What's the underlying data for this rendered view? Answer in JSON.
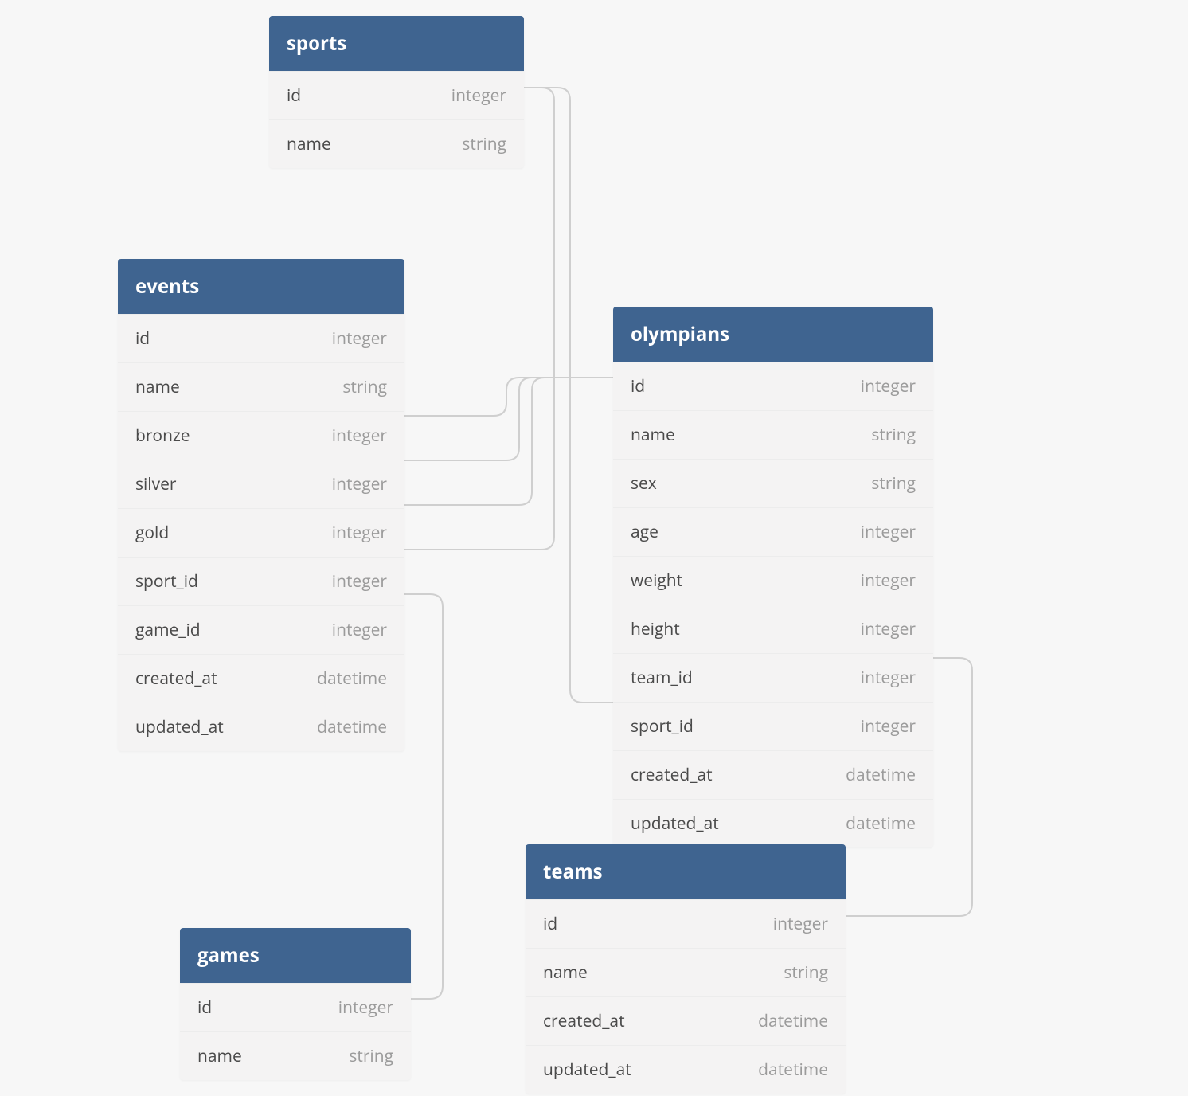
{
  "tables": {
    "sports": {
      "title": "sports",
      "columns": [
        {
          "name": "id",
          "type": "integer"
        },
        {
          "name": "name",
          "type": "string"
        }
      ]
    },
    "events": {
      "title": "events",
      "columns": [
        {
          "name": "id",
          "type": "integer"
        },
        {
          "name": "name",
          "type": "string"
        },
        {
          "name": "bronze",
          "type": "integer"
        },
        {
          "name": "silver",
          "type": "integer"
        },
        {
          "name": "gold",
          "type": "integer"
        },
        {
          "name": "sport_id",
          "type": "integer"
        },
        {
          "name": "game_id",
          "type": "integer"
        },
        {
          "name": "created_at",
          "type": "datetime"
        },
        {
          "name": "updated_at",
          "type": "datetime"
        }
      ]
    },
    "olympians": {
      "title": "olympians",
      "columns": [
        {
          "name": "id",
          "type": "integer"
        },
        {
          "name": "name",
          "type": "string"
        },
        {
          "name": "sex",
          "type": "string"
        },
        {
          "name": "age",
          "type": "integer"
        },
        {
          "name": "weight",
          "type": "integer"
        },
        {
          "name": "height",
          "type": "integer"
        },
        {
          "name": "team_id",
          "type": "integer"
        },
        {
          "name": "sport_id",
          "type": "integer"
        },
        {
          "name": "created_at",
          "type": "datetime"
        }
      ]
    },
    "olympians_extra_last": {
      "name": "updated_at",
      "type": "datetime"
    },
    "games": {
      "title": "games",
      "columns": [
        {
          "name": "id",
          "type": "integer"
        },
        {
          "name": "name",
          "type": "string"
        }
      ]
    },
    "teams": {
      "title": "teams",
      "columns": [
        {
          "name": "id",
          "type": "integer"
        },
        {
          "name": "name",
          "type": "string"
        },
        {
          "name": "created_at",
          "type": "datetime"
        },
        {
          "name": "updated_at",
          "type": "datetime"
        }
      ]
    }
  },
  "relationships": [
    {
      "from": "events.sport_id",
      "to": "sports.id"
    },
    {
      "from": "events.game_id",
      "to": "games.id"
    },
    {
      "from": "events.bronze",
      "to": "olympians.id"
    },
    {
      "from": "events.silver",
      "to": "olympians.id"
    },
    {
      "from": "events.gold",
      "to": "olympians.id"
    },
    {
      "from": "olympians.sport_id",
      "to": "sports.id"
    },
    {
      "from": "olympians.team_id",
      "to": "teams.id"
    }
  ]
}
